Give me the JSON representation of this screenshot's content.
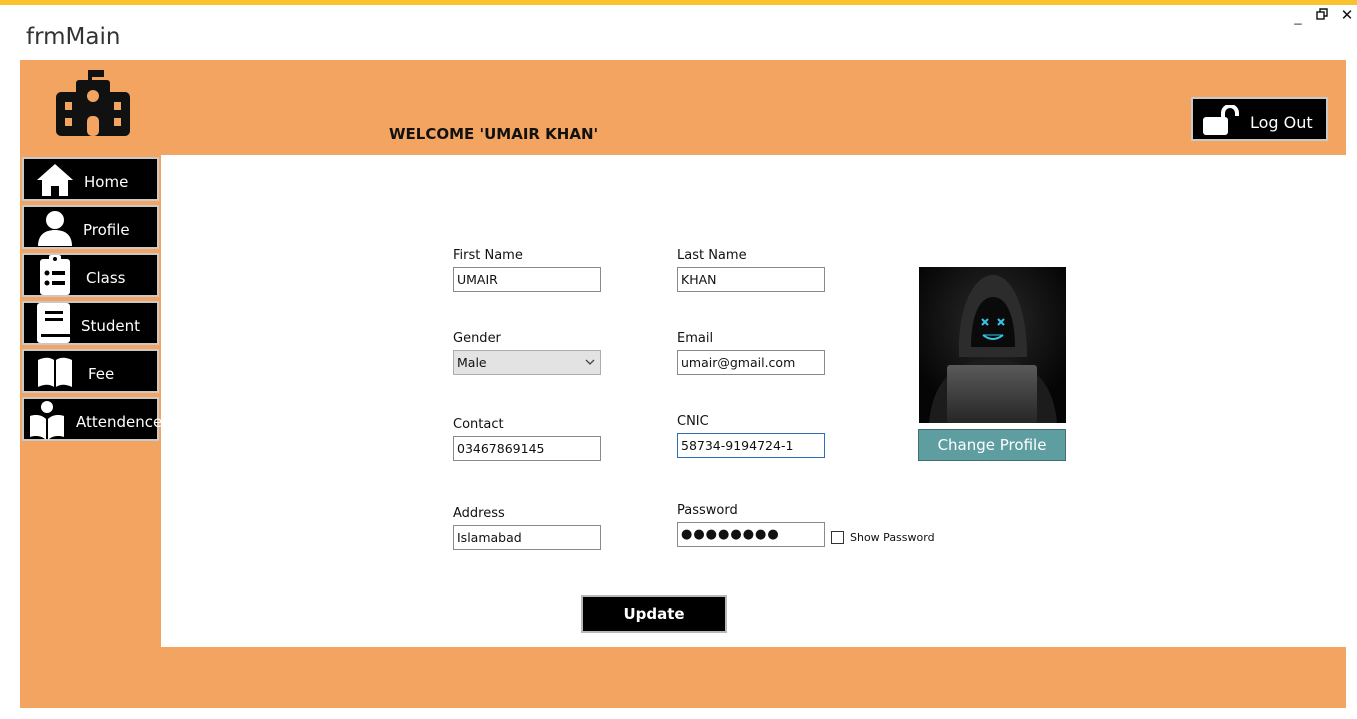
{
  "window": {
    "title": "frmMain",
    "minimize_glyph": "_",
    "restore_glyph": "🗗",
    "close_glyph": "✕"
  },
  "header": {
    "welcome_text": "WELCOME  'UMAIR KHAN'",
    "logo_icon": "school-icon",
    "logout_label": "Log Out"
  },
  "sidebar": {
    "items": [
      {
        "label": "Home",
        "icon": "home-icon"
      },
      {
        "label": "Profile",
        "icon": "user-icon"
      },
      {
        "label": "Class",
        "icon": "clipboard-list-icon"
      },
      {
        "label": "Student",
        "icon": "book-icon"
      },
      {
        "label": "Fee",
        "icon": "open-book-icon"
      },
      {
        "label": "Attendence",
        "icon": "reader-icon"
      }
    ]
  },
  "form": {
    "first_name": {
      "label": "First Name",
      "value": "UMAIR"
    },
    "last_name": {
      "label": "Last Name",
      "value": "KHAN"
    },
    "gender": {
      "label": "Gender",
      "value": "Male"
    },
    "email": {
      "label": "Email",
      "value": "umair@gmail.com"
    },
    "contact": {
      "label": "Contact",
      "value": "03467869145"
    },
    "cnic": {
      "label": "CNIC",
      "value": "58734-9194724-1"
    },
    "address": {
      "label": "Address",
      "value": "Islamabad"
    },
    "password": {
      "label": "Password",
      "value": "●●●●●●●●"
    },
    "show_password_label": "Show Password",
    "change_profile_label": "Change Profile",
    "update_label": "Update"
  },
  "colors": {
    "accent": "#f3a460",
    "topbar": "#f9c22e",
    "change_profile_bg": "#5f9ea0"
  }
}
